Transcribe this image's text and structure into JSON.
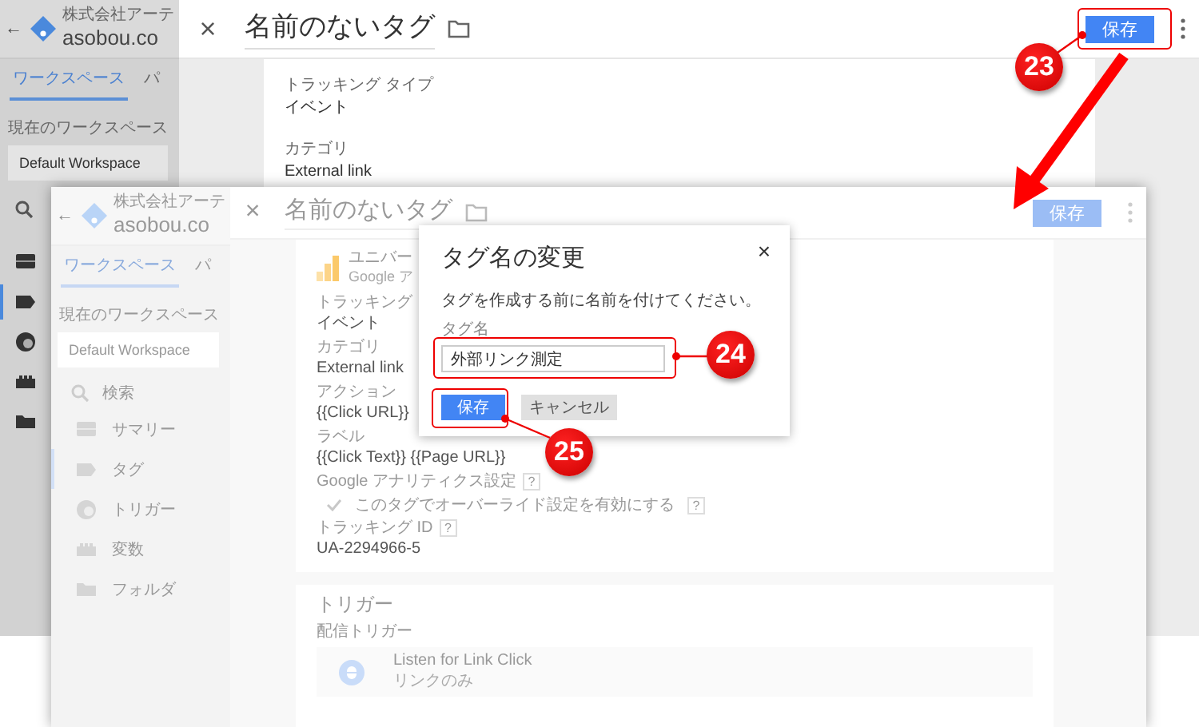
{
  "background_screenshot": {
    "back": "←",
    "account": "株式会社アーテ",
    "container": "asobou.co",
    "tabs": [
      {
        "label": "ワークスペース",
        "selected": true
      },
      {
        "label": "パ",
        "selected": false
      }
    ],
    "workspace_label": "現在のワークスペース",
    "workspace": "Default Workspace",
    "nav_icons": [
      {
        "kind": "summary",
        "selected": false
      },
      {
        "kind": "tag",
        "selected": true
      },
      {
        "kind": "trigger",
        "selected": false
      },
      {
        "kind": "variable",
        "selected": false
      },
      {
        "kind": "folder",
        "selected": false
      }
    ],
    "panel": {
      "close": "×",
      "title": "名前のないタグ",
      "save_button": {
        "label": "保存",
        "disabled": false
      },
      "fields": [
        {
          "label": "トラッキング タイプ",
          "value": "イベント"
        },
        {
          "label": "カテゴリ",
          "value": "External link"
        }
      ]
    }
  },
  "foreground_screenshot": {
    "back": "←",
    "account": "株式会社アーテ",
    "container": "asobou.co",
    "tabs": [
      {
        "label": "ワークスペース",
        "selected": true
      },
      {
        "label": "パ",
        "selected": false
      }
    ],
    "workspace_label": "現在のワークスペース",
    "workspace": "Default Workspace",
    "search": {
      "placeholder": "検索"
    },
    "nav": [
      {
        "kind": "summary",
        "label": "サマリー",
        "selected": false
      },
      {
        "kind": "tag",
        "label": "タグ",
        "selected": true
      },
      {
        "kind": "trigger",
        "label": "トリガー",
        "selected": false
      },
      {
        "kind": "variable",
        "label": "変数",
        "selected": false
      },
      {
        "kind": "folder",
        "label": "フォルダ",
        "selected": false
      }
    ],
    "panel": {
      "close": "×",
      "title": "名前のないタグ",
      "save_button": {
        "label": "保存",
        "disabled": true
      },
      "tag_type": {
        "name": "ユニバー",
        "subtitle": "Google ア"
      },
      "fields": [
        {
          "label": "トラッキング",
          "value": "イベント"
        },
        {
          "label": "カテゴリ",
          "value": "External link"
        },
        {
          "label": "アクション",
          "value": "{{Click URL}}"
        },
        {
          "label": "ラベル",
          "value": "{{Click Text}} {{Page URL}}"
        }
      ],
      "ga_settings": {
        "label": "Google アナリティクス設定",
        "help": "?",
        "override": {
          "label": "このタグでオーバーライド設定を有効にする",
          "checked": true,
          "help": "?"
        }
      },
      "tracking_id": {
        "label": "トラッキング ID",
        "help": "?",
        "value": "UA-2294966-5"
      },
      "triggers": {
        "title": "トリガー",
        "label": "配信トリガー",
        "items": [
          {
            "name": "Listen for Link Click",
            "detail": "リンクのみ"
          }
        ]
      }
    }
  },
  "dialog": {
    "title": "タグ名の変更",
    "close": "×",
    "message": "タグを作成する前に名前を付けてください。",
    "field_label": "タグ名",
    "value": "外部リンク測定",
    "save_button": "保存",
    "cancel_button": "キャンセル"
  },
  "callouts": [
    {
      "number": "23"
    },
    {
      "number": "24"
    },
    {
      "number": "25"
    }
  ]
}
